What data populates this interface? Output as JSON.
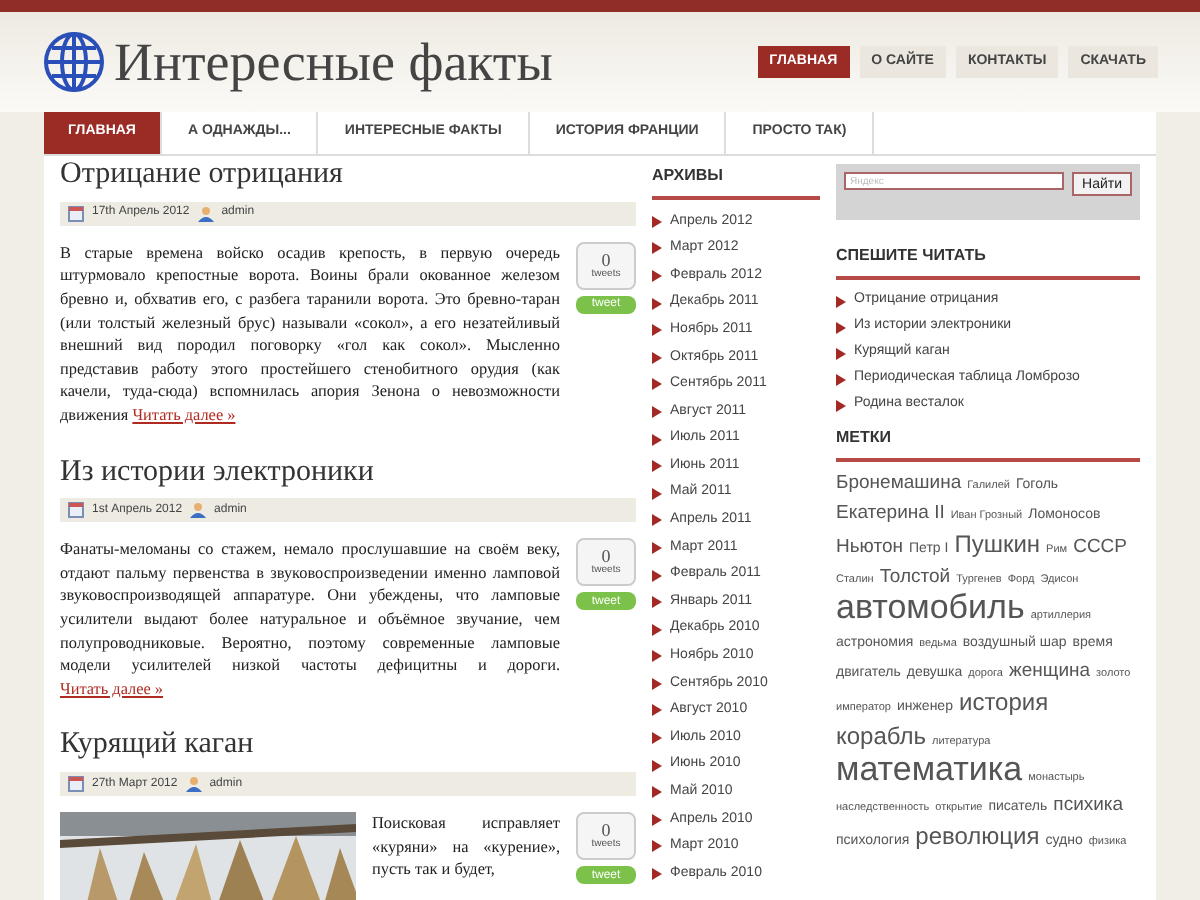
{
  "site": {
    "title": "Интересные факты"
  },
  "top_nav": [
    {
      "label": "ГЛАВНАЯ",
      "selected": true
    },
    {
      "label": "О САЙТЕ",
      "selected": false
    },
    {
      "label": "КОНТАКТЫ",
      "selected": false
    },
    {
      "label": "СКАЧАТЬ",
      "selected": false
    }
  ],
  "main_nav": [
    {
      "label": "ГЛАВНАЯ",
      "selected": true
    },
    {
      "label": "А ОДНАЖДЫ...",
      "selected": false
    },
    {
      "label": "ИНТЕРЕСНЫЕ ФАКТЫ",
      "selected": false
    },
    {
      "label": "ИСТОРИЯ ФРАНЦИИ",
      "selected": false
    },
    {
      "label": "ПРОСТО ТАК)",
      "selected": false
    }
  ],
  "posts": [
    {
      "title": "Отрицание отрицания",
      "date": "17th Апрель 2012",
      "author": "admin",
      "tweet_count": "0",
      "tweet_unit": "tweets",
      "tweet_button": "tweet",
      "text": "В старые времена войско осадив крепость, в первую очередь штурмовало крепостные ворота. Воины брали окованное железом бревно и, обхватив его, с разбега таранили ворота. Это бревно-таран (или толстый железный брус) называли «сокол», а его  незатейливый внешний вид породил поговорку «гол как сокол». Мысленно представив работу этого простейшего стенобитного орудия (как качели, туда-сюда) вспомнилась апория Зенона о невозможности движения",
      "more": "Читать далее »"
    },
    {
      "title": "Из истории электроники",
      "date": "1st Апрель 2012",
      "author": "admin",
      "tweet_count": "0",
      "tweet_unit": "tweets",
      "tweet_button": "tweet",
      "text": "Фанаты-меломаны со стажем, немало прослушавшие на своём веку, отдают пальму первенства в звуковоспроизведении именно ламповой звуковоспроизводящей аппаратуре. Они убеждены, что ламповые усилители выдают более натуральное и объёмное звучание, чем полупроводниковые. Вероятно, поэтому современные ламповые модели усилителей низкой частоты дефицитны и дороги.",
      "more": "Читать далее »"
    },
    {
      "title": "Курящий каган",
      "date": "27th Март 2012",
      "author": "admin",
      "tweet_count": "0",
      "tweet_unit": "tweets",
      "tweet_button": "tweet",
      "text": "Поисковая исправляет «куряни» на «курение», пусть так и будет,"
    }
  ],
  "archives": {
    "title": "АРХИВЫ",
    "items": [
      "Апрель 2012",
      "Март 2012",
      "Февраль 2012",
      "Декабрь 2011",
      "Ноябрь 2011",
      "Октябрь 2011",
      "Сентябрь 2011",
      "Август 2011",
      "Июль 2011",
      "Июнь 2011",
      "Май 2011",
      "Апрель 2011",
      "Март 2011",
      "Февраль 2011",
      "Январь 2011",
      "Декабрь 2010",
      "Ноябрь 2010",
      "Сентябрь 2010",
      "Август 2010",
      "Июль 2010",
      "Июнь 2010",
      "Май 2010",
      "Апрель 2010",
      "Март 2010",
      "Февраль 2010"
    ]
  },
  "search": {
    "placeholder": "Яндекс",
    "button": "Найти"
  },
  "recent": {
    "title": "СПЕШИТЕ ЧИТАТЬ",
    "items": [
      "Отрицание отрицания",
      "Из истории электроники",
      "Курящий каган",
      "Периодическая таблица Ломброзо",
      "Родина весталок"
    ]
  },
  "tags": {
    "title": "МЕТКИ",
    "items": [
      {
        "label": "Бронемашина",
        "kind": "md"
      },
      {
        "label": "Галилей",
        "kind": "xs"
      },
      {
        "label": "Гоголь",
        "kind": "sm"
      },
      {
        "label": "Екатерина II",
        "kind": "md"
      },
      {
        "label": "Иван Грозный",
        "kind": "xs"
      },
      {
        "label": "Ломоносов",
        "kind": "sm"
      },
      {
        "label": "Ньютон",
        "kind": "md"
      },
      {
        "label": "Петр I",
        "kind": "sm"
      },
      {
        "label": "Пушкин",
        "kind": "lg"
      },
      {
        "label": "Рим",
        "kind": "xs"
      },
      {
        "label": "СССР",
        "kind": "md"
      },
      {
        "label": "Сталин",
        "kind": "xs"
      },
      {
        "label": "Толстой",
        "kind": "md"
      },
      {
        "label": "Тургенев",
        "kind": "xs"
      },
      {
        "label": "Форд",
        "kind": "xs"
      },
      {
        "label": "Эдисон",
        "kind": "xs"
      },
      {
        "label": "автомобиль",
        "kind": "xl"
      },
      {
        "label": "артиллерия",
        "kind": "xs"
      },
      {
        "label": "астрономия",
        "kind": "sm"
      },
      {
        "label": "ведьма",
        "kind": "xs"
      },
      {
        "label": "воздушный шар",
        "kind": "sm"
      },
      {
        "label": "время",
        "kind": "sm"
      },
      {
        "label": "двигатель",
        "kind": "sm"
      },
      {
        "label": "девушка",
        "kind": "sm"
      },
      {
        "label": "дорога",
        "kind": "xs"
      },
      {
        "label": "женщина",
        "kind": "md"
      },
      {
        "label": "золото",
        "kind": "xs"
      },
      {
        "label": "император",
        "kind": "xs"
      },
      {
        "label": "инженер",
        "kind": "sm"
      },
      {
        "label": "история",
        "kind": "lg"
      },
      {
        "label": "корабль",
        "kind": "lg"
      },
      {
        "label": "литература",
        "kind": "xs"
      },
      {
        "label": "математика",
        "kind": "xl"
      },
      {
        "label": "монастырь",
        "kind": "xs"
      },
      {
        "label": "наследственность",
        "kind": "xs"
      },
      {
        "label": "открытие",
        "kind": "xs"
      },
      {
        "label": "писатель",
        "kind": "sm"
      },
      {
        "label": "психика",
        "kind": "md"
      },
      {
        "label": "психология",
        "kind": "sm"
      },
      {
        "label": "революция",
        "kind": "lg"
      },
      {
        "label": "судно",
        "kind": "sm"
      },
      {
        "label": "физика",
        "kind": "xs"
      }
    ]
  }
}
